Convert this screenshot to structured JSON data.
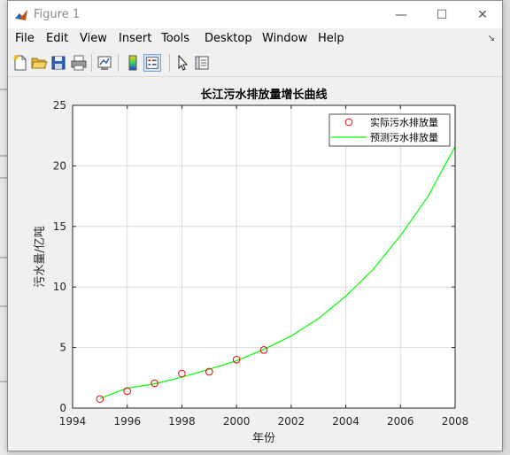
{
  "window": {
    "title": "Figure 1",
    "controls": {
      "minimize": "—",
      "maximize": "☐",
      "close": "✕"
    }
  },
  "menubar": {
    "items": [
      "File",
      "Edit",
      "View",
      "Insert",
      "Tools",
      "Desktop",
      "Window",
      "Help"
    ],
    "overflow": "↘"
  },
  "toolbar": {
    "buttons": [
      "new-figure-icon",
      "open-file-icon",
      "save-icon",
      "print-icon",
      "link-plot-icon",
      "colorbar-icon",
      "legend-icon",
      "pointer-icon",
      "property-inspector-icon"
    ],
    "selected": "legend-icon"
  },
  "colors": {
    "observed": "#e8000b",
    "predicted": "#00ff00",
    "grid": "#dcdcdc",
    "axes": "#262626"
  },
  "chart_data": {
    "type": "line",
    "title": "长江污水排放量增长曲线",
    "xlabel": "年份",
    "ylabel": "污水量/亿吨",
    "xlim": [
      1994,
      2008
    ],
    "ylim": [
      0,
      25
    ],
    "xticks": [
      1994,
      1996,
      1998,
      2000,
      2002,
      2004,
      2006,
      2008
    ],
    "yticks": [
      0,
      5,
      10,
      15,
      20,
      25
    ],
    "grid": true,
    "legend_position": "top-right",
    "series": [
      {
        "name": "实际污水排放量",
        "style": "markers",
        "marker": "circle",
        "x": [
          1995,
          1996,
          1997,
          1998,
          1999,
          2000,
          2001
        ],
        "y": [
          0.75,
          1.4,
          2.05,
          2.85,
          3.0,
          4.0,
          4.8
        ]
      },
      {
        "name": "预测污水排放量",
        "style": "line",
        "x": [
          1995,
          1996,
          1997,
          1998,
          1999,
          2000,
          2001,
          2002,
          2003,
          2004,
          2005,
          2006,
          2007,
          2008
        ],
        "y": [
          0.8,
          1.65,
          2.0,
          2.55,
          3.2,
          3.9,
          4.85,
          5.95,
          7.4,
          9.25,
          11.45,
          14.25,
          17.45,
          21.6
        ]
      }
    ]
  }
}
